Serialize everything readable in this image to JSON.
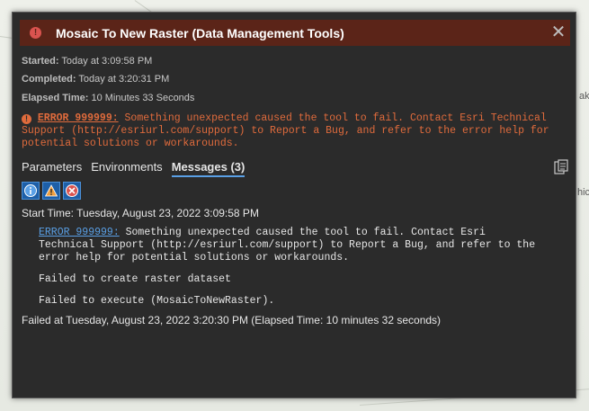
{
  "dialog": {
    "title": "Mosaic To New Raster (Data Management Tools)",
    "title_icon": "!",
    "close_glyph": "✕"
  },
  "meta": {
    "started_label": "Started:",
    "started_value": "Today at 3:09:58 PM",
    "completed_label": "Completed:",
    "completed_value": "Today at 3:20:31 PM",
    "elapsed_label": "Elapsed Time:",
    "elapsed_value": "10 Minutes 33 Seconds"
  },
  "error": {
    "code": "ERROR 999999:",
    "text": "Something unexpected caused the tool to fail. Contact Esri Technical Support (http://esriurl.com/support) to Report a Bug, and refer to the error help for potential solutions or workarounds."
  },
  "tabs": [
    {
      "label": "Parameters"
    },
    {
      "label": "Environments"
    },
    {
      "label": "Messages (3)"
    }
  ],
  "messages": {
    "start_time": "Start Time: Tuesday, August 23, 2022 3:09:58 PM",
    "error_code": "ERROR 999999:",
    "error_text": "Something unexpected caused the tool to fail. Contact Esri Technical Support (http://esriurl.com/support) to Report a Bug, and refer to the error help for potential solutions or workarounds.",
    "line2": "Failed to create raster dataset",
    "line3": "Failed to execute (MosaicToNewRaster).",
    "footer": "Failed at Tuesday, August 23, 2022 3:20:30 PM (Elapsed Time: 10 minutes 32 seconds)"
  },
  "icons": {
    "filter_info": "info-icon",
    "filter_warning": "warning-icon",
    "filter_error": "error-icon",
    "copy": "copy-icon"
  },
  "map_labels": {
    "right_top": "ak",
    "right_mid": "hic"
  },
  "colors": {
    "titlebar": "#5b2418",
    "error_text": "#e06b3c",
    "accent": "#5aa0e6"
  }
}
